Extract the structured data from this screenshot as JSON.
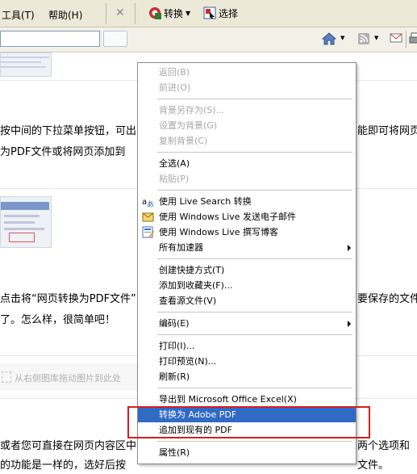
{
  "menubar": {
    "tools": "工具(T)",
    "help": "帮助(H)",
    "convert": "转换",
    "select": "选择"
  },
  "content": {
    "line1": "按中间的下拉菜单按钮，可出",
    "line1_right": "能即可将网页",
    "line2": "为PDF文件或将网页添加到",
    "line3": "点击将“网页转换为PDF文件”",
    "line3_right": "要保存的文件",
    "line4": "了。怎么样，很简单吧！",
    "drop_hint": "从右侧图库拖动图片到此处",
    "line5": "或者您可直接在网页内容区中",
    "line5_right": "两个选项和",
    "line6": "的功能是一样的，选好后按",
    "line6_right": "文件。"
  },
  "context_menu": {
    "back": "返回(B)",
    "forward": "前进(O)",
    "save_background": "背景另存为(S)...",
    "set_background": "设置为背景(G)",
    "copy_background": "复制背景(C)",
    "select_all": "全选(A)",
    "paste": "粘贴(P)",
    "live_search": "使用 Live Search 转换",
    "live_mail": "使用 Windows Live 发送电子邮件",
    "live_blog": "使用 Windows Live 撰写博客",
    "all_accelerators": "所有加速器",
    "create_shortcut": "创建快捷方式(T)",
    "add_favorites": "添加到收藏夹(F)...",
    "view_source": "查看源文件(V)",
    "encoding": "编码(E)",
    "print": "打印(I)...",
    "print_preview": "打印预览(N)...",
    "refresh": "刷新(R)",
    "export_excel": "导出到 Microsoft Office Excel(X)",
    "convert_pdf": "转换为 Adobe PDF",
    "append_pdf": "追加到现有的 PDF",
    "properties": "属性(R)"
  },
  "icons": {
    "convert": "adobe-convert-icon",
    "select": "select-icon",
    "home": "home-icon",
    "feed": "rss-feed-icon",
    "mail": "mail-icon",
    "print": "print-icon",
    "live_search": "translate-icon",
    "live_mail": "mail-icon",
    "live_blog": "blog-icon"
  },
  "colors": {
    "highlight": "#316ac5",
    "annotation": "#d21f1f",
    "disabled_text": "#a7a6aa"
  }
}
